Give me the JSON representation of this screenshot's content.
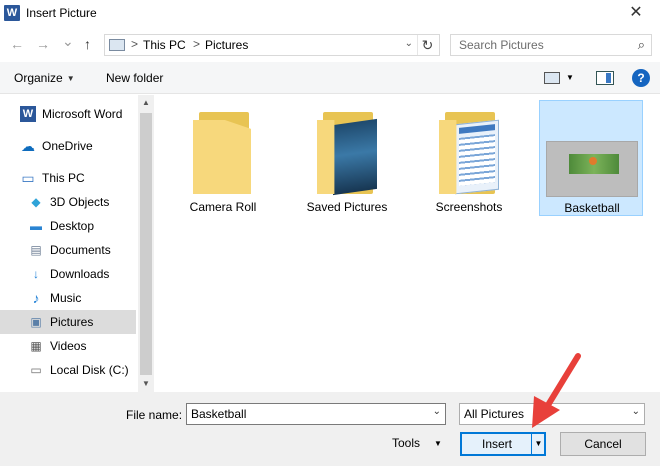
{
  "window": {
    "title": "Insert Picture",
    "app_icon_letter": "W",
    "close_glyph": "✕"
  },
  "nav": {
    "back_glyph": "←",
    "forward_glyph": "→",
    "recent_glyph": "⌄",
    "up_glyph": "↑"
  },
  "address": {
    "crumbs": [
      "This PC",
      "Pictures"
    ],
    "separator": ">",
    "refresh_glyph": "↻",
    "dropdown_glyph": "⌄"
  },
  "search": {
    "placeholder": "Search Pictures",
    "icon_glyph": "⌕"
  },
  "toolbar": {
    "organize_label": "Organize",
    "new_folder_label": "New folder",
    "help_glyph": "?"
  },
  "sidebar": {
    "items": [
      {
        "label": "Microsoft Word",
        "icon": "word-icon",
        "glyph": "W",
        "color": "#2b579a"
      },
      {
        "label": "OneDrive",
        "icon": "cloud-icon",
        "glyph": "☁",
        "color": "#0f6cbd"
      },
      {
        "label": "This PC",
        "icon": "computer-icon",
        "glyph": "▭",
        "color": "#3a78c4"
      },
      {
        "label": "3D Objects",
        "icon": "cube-icon",
        "glyph": "◆",
        "color": "#2fa3d8"
      },
      {
        "label": "Desktop",
        "icon": "desktop-icon",
        "glyph": "▬",
        "color": "#2a84d2"
      },
      {
        "label": "Documents",
        "icon": "documents-icon",
        "glyph": "▤",
        "color": "#6b7c93"
      },
      {
        "label": "Downloads",
        "icon": "download-icon",
        "glyph": "↓",
        "color": "#1e7fd6"
      },
      {
        "label": "Music",
        "icon": "music-icon",
        "glyph": "♪",
        "color": "#1e7fd6"
      },
      {
        "label": "Pictures",
        "icon": "pictures-icon",
        "glyph": "▣",
        "color": "#5a7fa8"
      },
      {
        "label": "Videos",
        "icon": "videos-icon",
        "glyph": "▦",
        "color": "#555555"
      },
      {
        "label": "Local Disk (C:)",
        "icon": "disk-icon",
        "glyph": "▭",
        "color": "#707070"
      }
    ],
    "selected": "Pictures"
  },
  "content": {
    "items": [
      {
        "label": "Camera Roll",
        "kind": "folder"
      },
      {
        "label": "Saved Pictures",
        "kind": "folder-photo"
      },
      {
        "label": "Screenshots",
        "kind": "folder-screens"
      },
      {
        "label": "Basketball",
        "kind": "image"
      }
    ],
    "selected": "Basketball"
  },
  "bottom": {
    "file_name_label": "File name:",
    "file_name_value": "Basketball",
    "filter_value": "All Pictures",
    "tools_label": "Tools",
    "insert_label": "Insert",
    "cancel_label": "Cancel"
  },
  "colors": {
    "accent": "#0078d7",
    "selection": "#cce8ff",
    "annotation_arrow": "#e8403a"
  }
}
